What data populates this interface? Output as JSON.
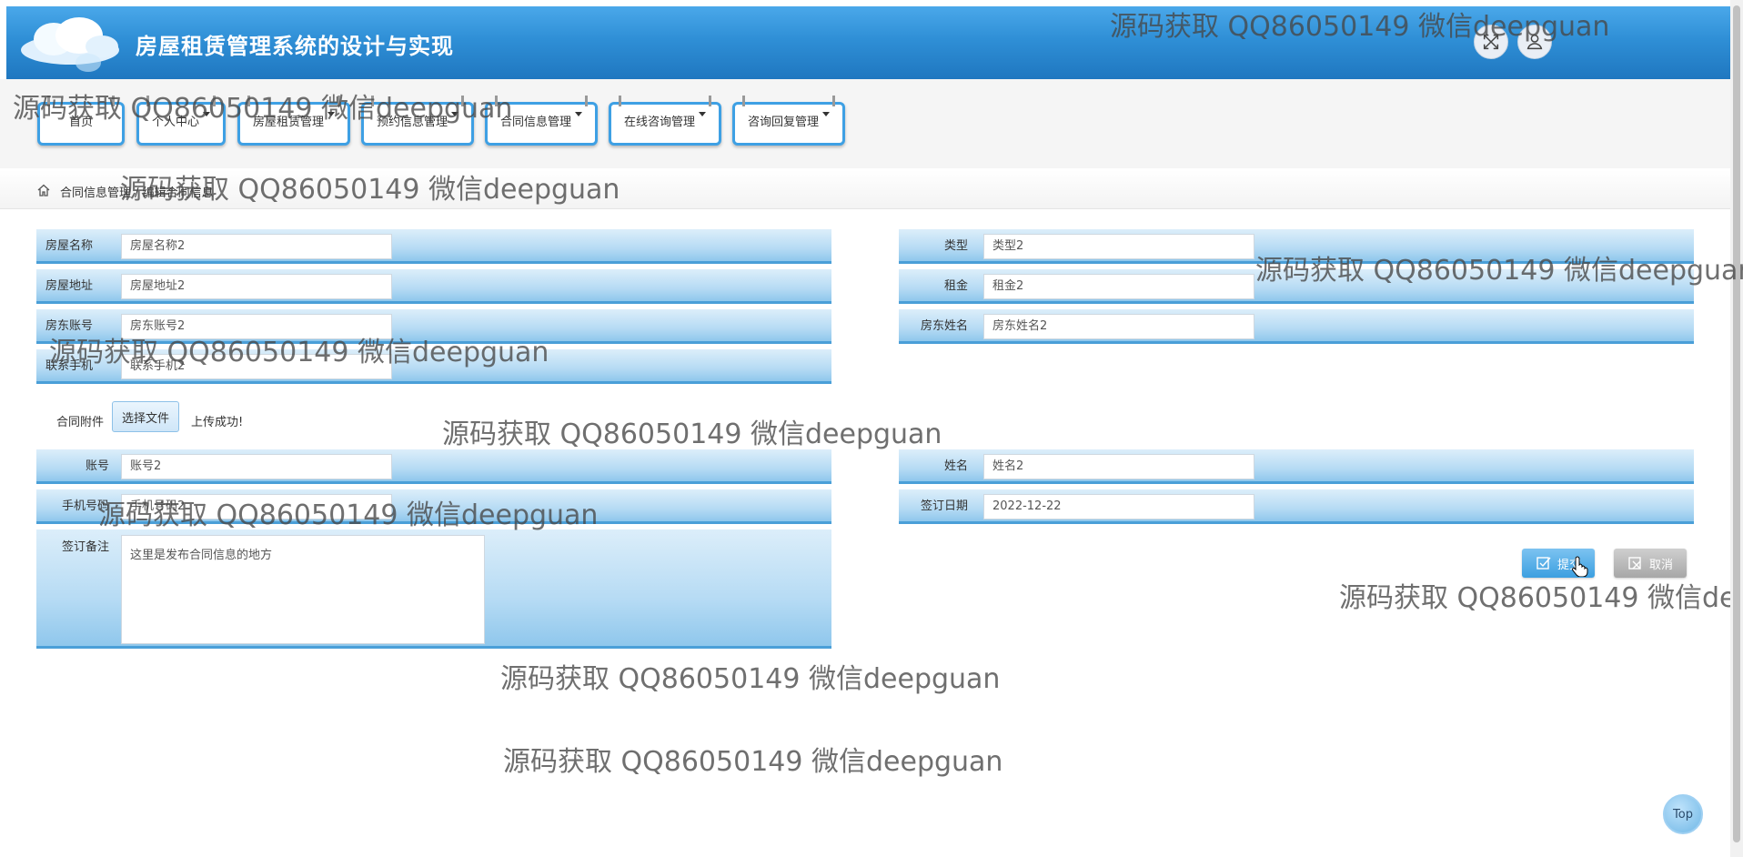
{
  "header": {
    "title": "房屋租赁管理系统的设计与实现"
  },
  "nav": {
    "items": [
      {
        "label": "首页",
        "dropdown": false
      },
      {
        "label": "个人中心",
        "dropdown": true
      },
      {
        "label": "房屋租赁管理",
        "dropdown": true
      },
      {
        "label": "预约信息管理",
        "dropdown": true
      },
      {
        "label": "合同信息管理",
        "dropdown": true
      },
      {
        "label": "在线咨询管理",
        "dropdown": true
      },
      {
        "label": "咨询回复管理",
        "dropdown": true
      }
    ]
  },
  "breadcrumb": {
    "text": "合同信息管理 / 编辑合同信息"
  },
  "form": {
    "fangwumingcheng": {
      "label": "房屋名称",
      "value": "房屋名称2"
    },
    "leixing": {
      "label": "类型",
      "value": "类型2"
    },
    "fangwudizhi": {
      "label": "房屋地址",
      "value": "房屋地址2"
    },
    "zujin": {
      "label": "租金",
      "value": "租金2"
    },
    "fangdongzhanghao": {
      "label": "房东账号",
      "value": "房东账号2"
    },
    "fangdongxingming": {
      "label": "房东姓名",
      "value": "房东姓名2"
    },
    "lianxishouji": {
      "label": "联系手机",
      "value": "联系手机2"
    },
    "hetongfujian": {
      "label": "合同附件",
      "button": "选择文件",
      "message": "上传成功!"
    },
    "zhanghao": {
      "label": "账号",
      "value": "账号2"
    },
    "xingming": {
      "label": "姓名",
      "value": "姓名2"
    },
    "shoujihaoma": {
      "label": "手机号码",
      "value": "手机号码2"
    },
    "qiandingriqi": {
      "label": "签订日期",
      "value": "2022-12-22"
    },
    "qiandingbeizhu": {
      "label": "签订备注",
      "value": "这里是发布合同信息的地方"
    }
  },
  "actions": {
    "submit": "提交",
    "cancel": "取消",
    "top": "Top"
  },
  "watermark": {
    "text": "源码获取 QQ86050149 微信deepguan"
  },
  "colors": {
    "header": "#2f8fd6",
    "accent": "#3ea0e4",
    "row": "#b6dbf4"
  }
}
